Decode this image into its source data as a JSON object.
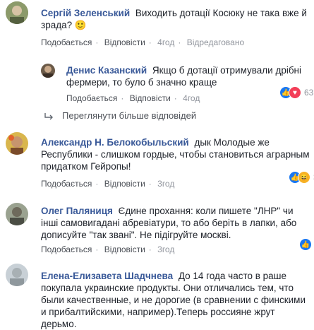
{
  "comments": [
    {
      "author": "Сергій Зеленський",
      "text": "Виходить дотації Косюку не така вже й зрада?",
      "emoji": "🙂",
      "actions": [
        "Подобається",
        "Відповісти",
        "4год",
        "Відредаговано"
      ]
    },
    {
      "author": "Денис Казанский",
      "text": "Якщо б дотації отримували дрібні фермери, то було б значно краще",
      "actions": [
        "Подобається",
        "Відповісти",
        "4год"
      ],
      "reaction_count": "63"
    },
    {
      "author": "Александр Н. Белокобыльский",
      "text": "дык Молодые же Республики - слишком гордые, чтобы становиться аграрным придатком Гейропы!",
      "actions": [
        "Подобається",
        "Відповісти",
        "3год"
      ],
      "reaction_count": "3"
    },
    {
      "author": "Олег Паляниця",
      "text": "Єдине прохання: коли пишете \"ЛНР\" чи інші самовигадані абревіатури, то або беріть в лапки, або дописуйте \"так звані\". Не підігруйте москві.",
      "actions": [
        "Подобається",
        "Відповісти",
        "3год"
      ]
    },
    {
      "author": "Елена-Елизавета Шадчнева",
      "text": "До 14 года часто в раше покупала украинские продукты. Они отличались тем, что были качественные, и не дорогие (в сравнении с финскими и прибалтийскими, например).Теперь россияне жрут дерьмо."
    }
  ],
  "more_replies": "Переглянути більше відповідей",
  "colors": {
    "name": "#385898",
    "meta": "#90949c",
    "like": "#1877f2"
  }
}
